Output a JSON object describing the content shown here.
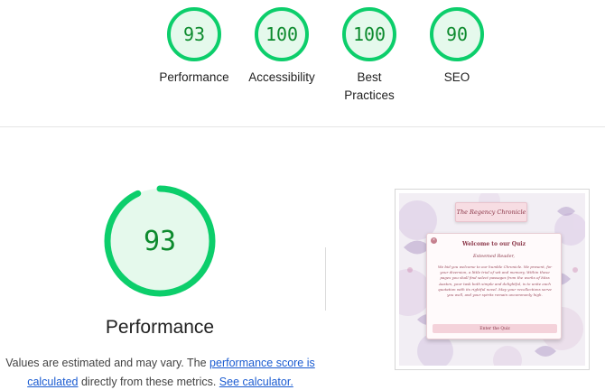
{
  "summary": {
    "gauges": [
      {
        "label": "Performance",
        "score": "93"
      },
      {
        "label": "Accessibility",
        "score": "100"
      },
      {
        "label": "Best\nPractices",
        "label_line1": "Best",
        "label_line2": "Practices",
        "score": "100"
      },
      {
        "label": "SEO",
        "score": "90"
      }
    ]
  },
  "main": {
    "score": "93",
    "label": "Performance",
    "note_prefix": "Values are estimated and may vary. The ",
    "note_link1": "performance score is calculated",
    "note_middle": " directly from these metrics. ",
    "note_link2": "See calculator."
  },
  "thumbnail": {
    "pill_title": "The Regency Chronicle",
    "card_title": "Welcome to our Quiz",
    "card_salute": "Esteemed Reader,",
    "card_body": "We bid you welcome to our humble Chronicle. We present, for your diversion, a little trial of wit and memory. Within these pages you shall find select passages from the works of Miss Austen, your task both simple and delightful, is to unite each quotation with its rightful novel. May your recollections serve you well, and your spirits remain uncommonly high.",
    "card_button": "Enter the Quiz"
  },
  "colors": {
    "pass_ring": "#0cce6b",
    "pass_fill": "#e5f9ec",
    "pass_text": "#0c8a2d",
    "link": "#1a5bd1"
  }
}
